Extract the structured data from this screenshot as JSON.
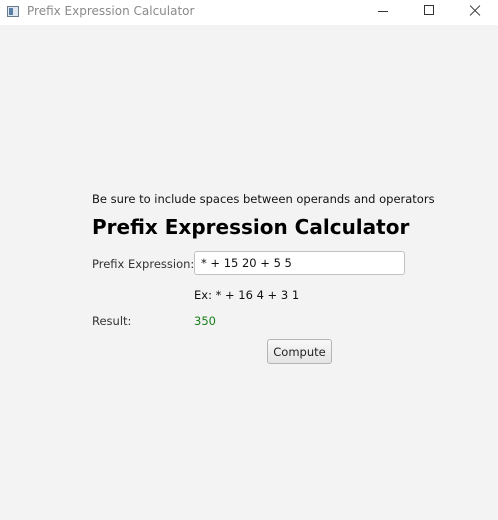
{
  "window": {
    "title": "Prefix Expression Calculator",
    "icon": "app-window-icon"
  },
  "form": {
    "hint": "Be sure to include spaces between operands and operators",
    "heading": "Prefix Expression Calculator",
    "expression_label": "Prefix Expression:",
    "expression_value": "* + 15 20 + 5 5",
    "example": "Ex: * + 16 4 + 3 1",
    "result_label": "Result:",
    "result_value": "350",
    "compute_label": "Compute"
  },
  "colors": {
    "result_text": "#1a7f1a"
  }
}
